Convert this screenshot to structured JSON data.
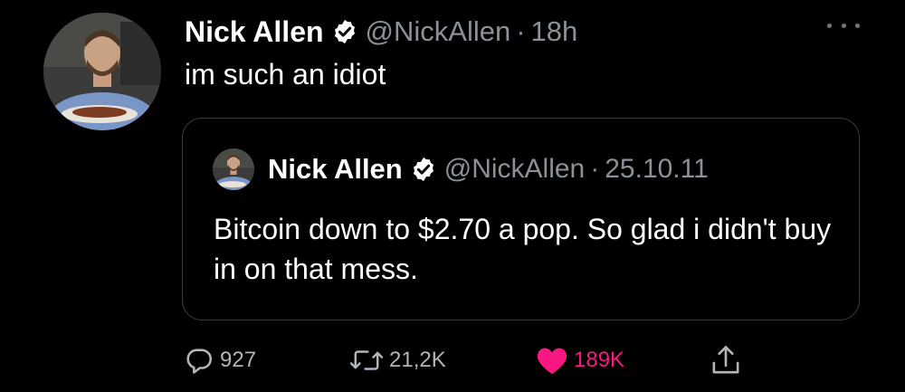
{
  "tweet": {
    "author_name": "Nick Allen",
    "handle": "@NickAllen",
    "separator": "·",
    "time": "18h",
    "text": "im such an idiot"
  },
  "quoted_tweet": {
    "author_name": "Nick Allen",
    "handle": "@NickAllen",
    "separator": "·",
    "date": "25.10.11",
    "text": "Bitcoin down to $2.70 a pop. So glad i didn't buy in on that mess."
  },
  "actions": {
    "reply_count": "927",
    "retweet_count": "21,2K",
    "like_count": "189K",
    "liked": true
  },
  "colors": {
    "background": "#000000",
    "text": "#ffffff",
    "secondary_text": "#8b9198",
    "verified_fill": "#ffffff",
    "like": "#f91880",
    "border": "#3a3e42"
  },
  "icons": [
    "verified-badge-icon",
    "more-options-icon",
    "reply-icon",
    "retweet-icon",
    "heart-icon",
    "share-icon"
  ]
}
